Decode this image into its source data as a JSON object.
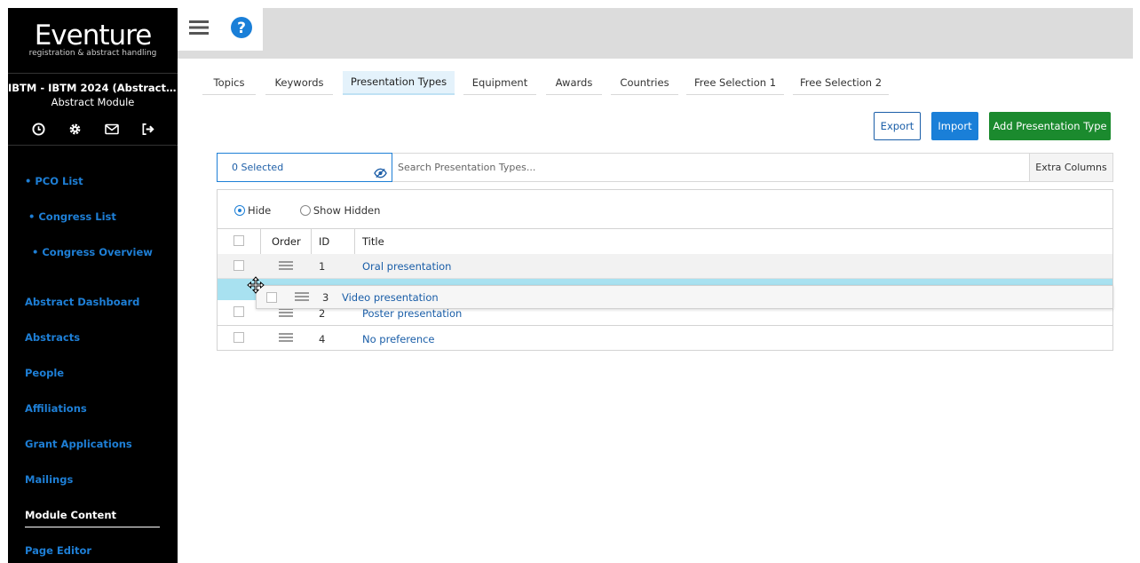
{
  "sidebar": {
    "logo_name": "Eventure",
    "logo_tagline": "registration & abstract handling",
    "event_name": "IBTM - IBTM 2024 (Abstracts & Par...",
    "module_name": "Abstract Module",
    "icons": [
      "clock-icon",
      "gear-icon",
      "mail-icon",
      "logout-icon"
    ],
    "nav": [
      {
        "label": "• PCO List"
      },
      {
        "label": "• Congress List"
      },
      {
        "label": "• Congress Overview"
      },
      {
        "label": "Abstract Dashboard"
      },
      {
        "label": "Abstracts"
      },
      {
        "label": "People"
      },
      {
        "label": "Affiliations"
      },
      {
        "label": "Grant Applications"
      },
      {
        "label": "Mailings"
      },
      {
        "label": "Module Content"
      },
      {
        "label": "Page Editor"
      }
    ],
    "active_item": "Module Content"
  },
  "topbar": {
    "menu_icon": "hamburger-icon",
    "help_icon": "help-icon"
  },
  "tabs": [
    {
      "label": "Topics"
    },
    {
      "label": "Keywords"
    },
    {
      "label": "Presentation Types"
    },
    {
      "label": "Equipment"
    },
    {
      "label": "Awards"
    },
    {
      "label": "Countries"
    },
    {
      "label": "Free Selection 1"
    },
    {
      "label": "Free Selection 2"
    }
  ],
  "active_tab": "Presentation Types",
  "actions": {
    "export": "Export",
    "import": "Import",
    "add": "Add Presentation Type"
  },
  "filter": {
    "selected": "0 Selected",
    "search_placeholder": "Search Presentation Types...",
    "extra_columns": "Extra Columns"
  },
  "visibility": {
    "hide": "Hide",
    "show_hidden": "Show Hidden",
    "selected": "Hide"
  },
  "table": {
    "headers": {
      "order": "Order",
      "id": "ID",
      "title": "Title"
    },
    "rows": [
      {
        "id": "1",
        "title": "Oral presentation"
      },
      {
        "id": "2",
        "title": "Poster presentation"
      },
      {
        "id": "4",
        "title": "No preference"
      }
    ],
    "dragging_row": {
      "id": "3",
      "title": "Video presentation"
    }
  },
  "colors": {
    "sidebar_bg": "#000000",
    "link": "#1e7fd6",
    "primary": "#1a7fd8",
    "success": "#1b8a2e",
    "drop_highlight": "#a8e1f0"
  }
}
